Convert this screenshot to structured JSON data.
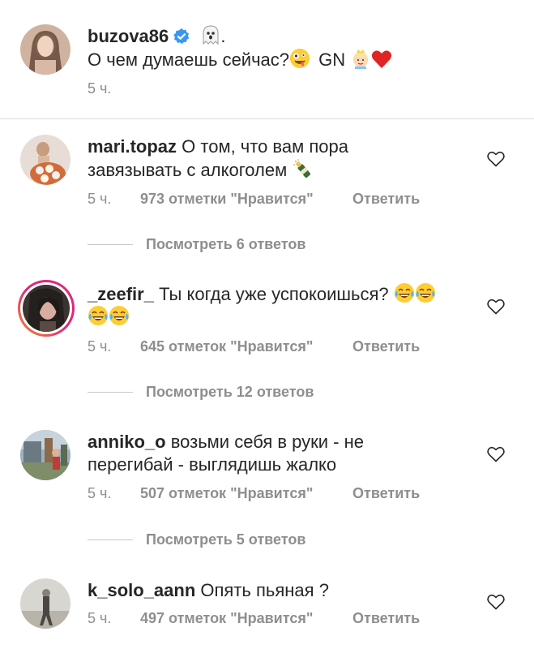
{
  "post": {
    "username": "buzova86",
    "dot": ".",
    "caption_text": "О чем думаешь сейчас?",
    "caption_gn": "GN",
    "time": "5 ч."
  },
  "comments": [
    {
      "username": "mari.topaz",
      "text_line1": "О том, что вам пора",
      "text_line2": "завязывать с алкоголем",
      "time": "5 ч.",
      "likes": "973 отметки \"Нравится\"",
      "reply": "Ответить",
      "view_replies": "Посмотреть 6 ответов"
    },
    {
      "username": "_zeefir_",
      "text_line1": "Ты когда уже успокоишься?",
      "text_line2": "",
      "time": "5 ч.",
      "likes": "645 отметок \"Нравится\"",
      "reply": "Ответить",
      "view_replies": "Посмотреть 12 ответов"
    },
    {
      "username": "anniko_o",
      "text_line1": "возьми себя в руки - не",
      "text_line2": "перегибай - выглядишь жалко",
      "time": "5 ч.",
      "likes": "507 отметок \"Нравится\"",
      "reply": "Ответить",
      "view_replies": "Посмотреть 5 ответов"
    },
    {
      "username": "k_solo_aann",
      "text_line1": "Опять пьяная ?",
      "text_line2": "",
      "time": "5 ч.",
      "likes": "497 отметок \"Нравится\"",
      "reply": "Ответить"
    }
  ],
  "icons": {
    "verified": "verified-badge-icon",
    "heart": "heart-outline-icon",
    "ghost": "ghost-emoji",
    "zany": "zany-face-emoji",
    "princess": "princess-emoji",
    "red_heart": "red-heart-emoji",
    "champagne": "champagne-emoji",
    "laughing": "tears-of-joy-emoji"
  },
  "colors": {
    "text": "#262626",
    "secondary": "#8e8e8e",
    "verified_blue": "#3897f0",
    "story_ring_start": "#f58529",
    "story_ring_end": "#dd2a7b"
  }
}
